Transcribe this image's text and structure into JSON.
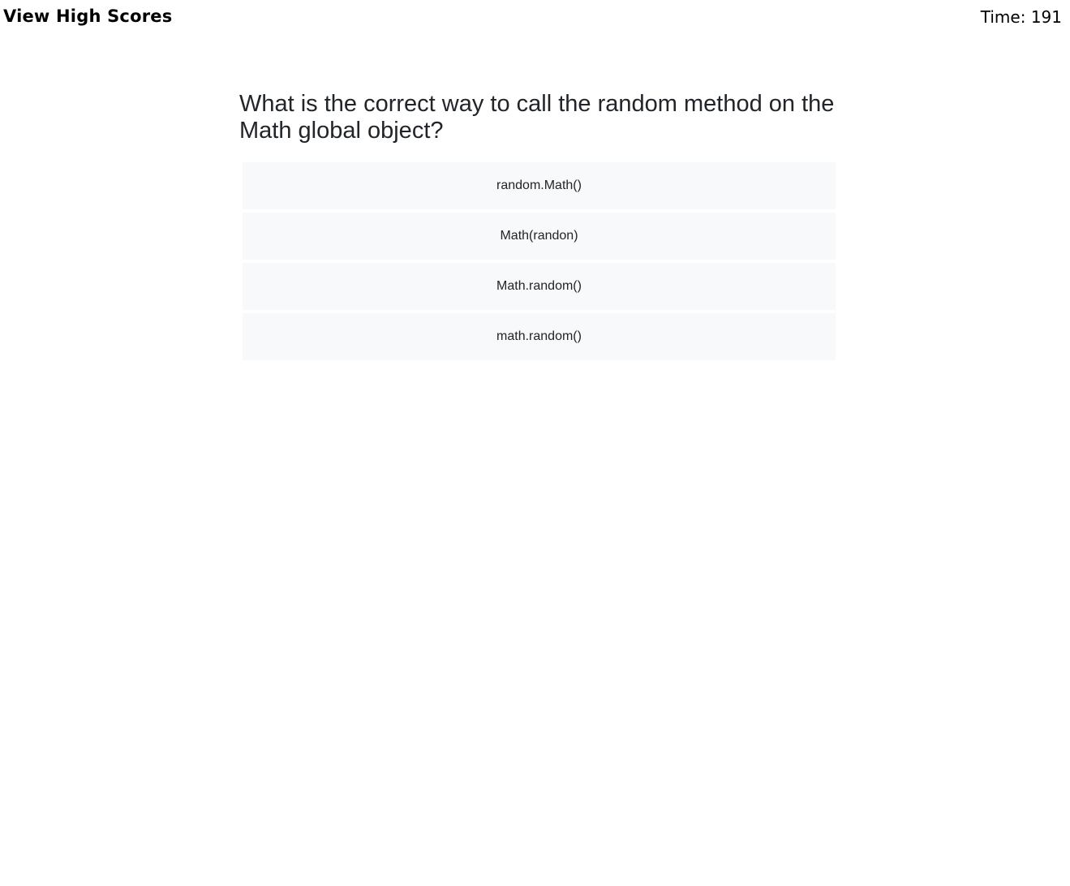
{
  "header": {
    "high_scores_label": "View High Scores",
    "timer_label": "Time: ",
    "timer_value": "191"
  },
  "quiz": {
    "question": "What is the correct way to call the random method on the Math global object?",
    "answers": [
      "random.Math()",
      "Math(randon)",
      "Math.random()",
      "math.random()"
    ]
  },
  "colors": {
    "answer_background": "#f8f9fa",
    "question_text": "#212529",
    "header_text": "#000000"
  }
}
